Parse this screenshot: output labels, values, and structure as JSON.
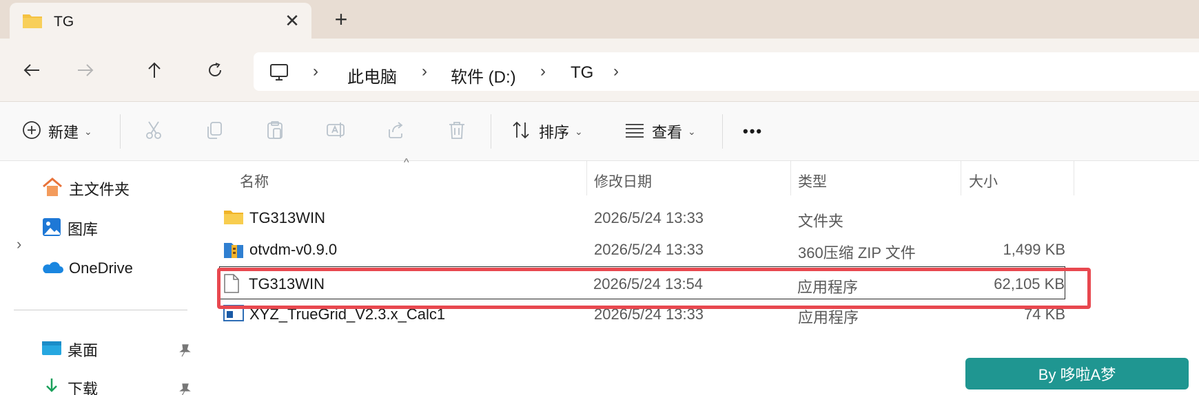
{
  "tab": {
    "title": "TG",
    "close_glyph": "✕",
    "new_tab_glyph": "+"
  },
  "nav": {
    "back_icon": "arrow-left-icon",
    "forward_icon": "arrow-right-icon",
    "up_icon": "arrow-up-icon",
    "refresh_icon": "refresh-icon"
  },
  "address": {
    "root_icon": "this-pc-icon",
    "crumbs": [
      "此电脑",
      "软件 (D:)",
      "TG"
    ],
    "separator": "›"
  },
  "toolbar": {
    "new_label": "新建",
    "sort_label": "排序",
    "view_label": "查看",
    "more_label": "•••",
    "caret": "⌄"
  },
  "sidebar": {
    "items": [
      {
        "label": "主文件夹",
        "icon": "home-icon"
      },
      {
        "label": "图库",
        "icon": "gallery-icon"
      },
      {
        "label": "OneDrive",
        "icon": "onedrive-icon",
        "expander": "›"
      },
      {
        "label": "桌面",
        "icon": "desktop-icon"
      },
      {
        "label": "下载",
        "icon": "download-icon"
      }
    ]
  },
  "columns": {
    "name": "名称",
    "date": "修改日期",
    "type": "类型",
    "size": "大小",
    "sort_glyph": "^"
  },
  "files": [
    {
      "name": "TG313WIN",
      "date": "2026/5/24 13:33",
      "type": "文件夹",
      "size": "",
      "icon": "folder-icon"
    },
    {
      "name": "otvdm-v0.9.0",
      "date": "2026/5/24 13:33",
      "type": "360压缩 ZIP 文件",
      "size": "1,499 KB",
      "icon": "zip-archive-icon"
    },
    {
      "name": "TG313WIN",
      "date": "2026/5/24 13:54",
      "type": "应用程序",
      "size": "62,105 KB",
      "icon": "blank-file-icon",
      "selected": true
    },
    {
      "name": "XYZ_TrueGrid_V2.3.x_Calc1",
      "date": "2026/5/24 13:33",
      "type": "应用程序",
      "size": "74 KB",
      "icon": "app-window-icon"
    }
  ],
  "watermark": "By 哆啦A梦",
  "colors": {
    "highlight": "#e8484f",
    "watermark_bg": "#1f9691",
    "folder": "#f5c242",
    "accent": "#0067c0"
  }
}
